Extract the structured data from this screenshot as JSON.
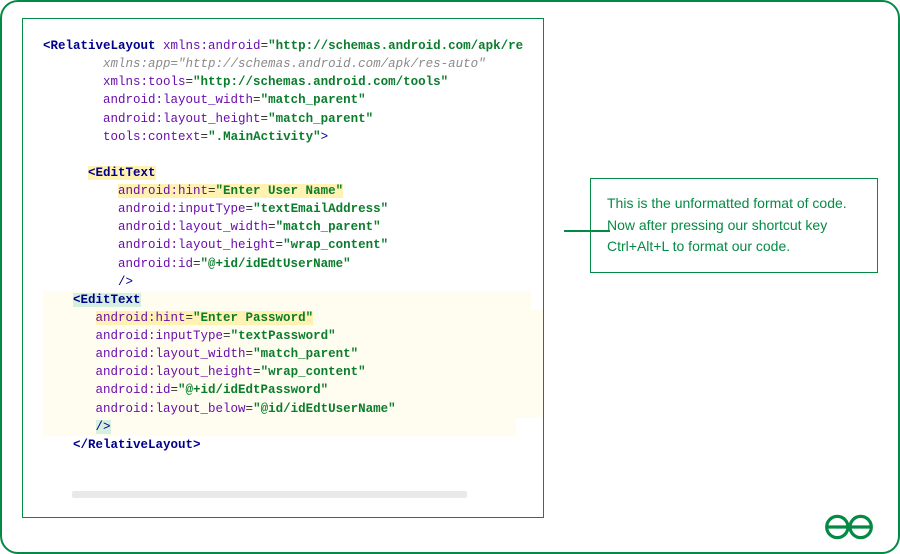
{
  "code": {
    "root_open": "<RelativeLayout",
    "root_close_open": ">",
    "root_close": "</RelativeLayout>",
    "ns_android": "xmlns:android",
    "ns_android_val": "\"http://schemas.android.com/apk/re",
    "ns_app": "xmlns:app",
    "ns_app_val": "\"http://schemas.android.com/apk/res-auto\"",
    "ns_tools": "xmlns:tools",
    "ns_tools_val": "\"http://schemas.android.com/tools\"",
    "a_lw": "android:layout_width",
    "a_lh": "android:layout_height",
    "a_mp": "\"match_parent\"",
    "a_wc": "\"wrap_content\"",
    "a_ctx": "tools:context",
    "a_ctx_val": "\".MainActivity\"",
    "edit_open": "<EditText",
    "hint": "android:hint",
    "hint1_val": "\"Enter User Name\"",
    "itype": "android:inputType",
    "itype1_val": "\"textEmailAddress\"",
    "id": "android:id",
    "id1_val": "\"@+id/idEdtUserName\"",
    "self_close": "/>",
    "hint2_val": "\"Enter Password\"",
    "itype2_val": "\"textPassword\"",
    "id2_val": "\"@+id/idEdtPassword\"",
    "below": "android:layout_below",
    "below_val": "\"@id/idEdtUserName\""
  },
  "callout": {
    "line1": "This is the unformatted format of code.",
    "line2": "Now after pressing our shortcut key",
    "line3": "Ctrl+Alt+L to format our code."
  },
  "logo": "GeeksforGeeks"
}
